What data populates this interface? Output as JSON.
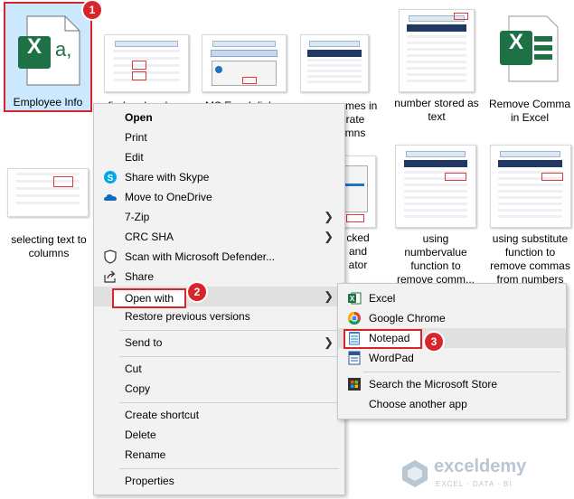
{
  "files": {
    "employee_info": "Employee Info",
    "find_replace": "find and replace",
    "ms_excel_dialog": "MS Excel dialog",
    "names_separate": [
      "names in",
      "rate",
      "mns"
    ],
    "number_stored": "number stored as text",
    "remove_comma": "Remove Comma in Excel",
    "selecting_text": "selecting text to columns",
    "checked": [
      "cked",
      "and",
      "ator"
    ],
    "numbervalue": "using numbervalue function to remove comm...",
    "substitute": "using substitute function to remove commas from numbers",
    "excel_icon_letter": "X",
    "excel_icon_suffix": "a,"
  },
  "context_menu": {
    "open": "Open",
    "print": "Print",
    "edit": "Edit",
    "share_skype": "Share with Skype",
    "move_onedrive": "Move to OneDrive",
    "seven_zip": "7-Zip",
    "crc_sha": "CRC SHA",
    "scan_defender": "Scan with Microsoft Defender...",
    "share": "Share",
    "open_with": "Open with",
    "restore": "Restore previous versions",
    "send_to": "Send to",
    "cut": "Cut",
    "copy": "Copy",
    "create_shortcut": "Create shortcut",
    "delete": "Delete",
    "rename": "Rename",
    "properties": "Properties"
  },
  "submenu": {
    "excel": "Excel",
    "chrome": "Google Chrome",
    "notepad": "Notepad",
    "wordpad": "WordPad",
    "search_store": "Search the Microsoft Store",
    "choose_app": "Choose another app"
  },
  "badges": {
    "one": "1",
    "two": "2",
    "three": "3"
  },
  "watermark": {
    "brand": "exceldemy",
    "tagline": "EXCEL · DATA · BI"
  },
  "colors": {
    "highlight": "#d6262b",
    "excel_green": "#1e7145",
    "menu_bg": "#f2f2f2"
  }
}
